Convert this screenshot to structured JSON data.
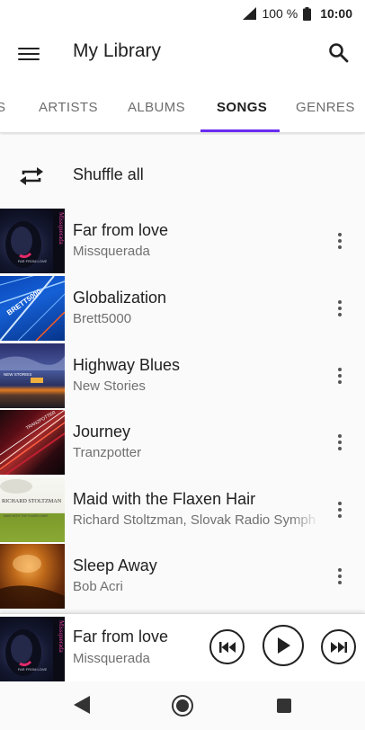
{
  "status": {
    "battery_percent": "100 %",
    "time": "10:00",
    "icons": [
      "signal-icon",
      "battery-icon"
    ]
  },
  "app": {
    "title": "My Library",
    "icons": [
      "menu-icon",
      "search-icon"
    ]
  },
  "tabs": [
    {
      "label": "S"
    },
    {
      "label": "ARTISTS"
    },
    {
      "label": "ALBUMS"
    },
    {
      "label": "SONGS",
      "active": true
    },
    {
      "label": "GENRES"
    }
  ],
  "accent_color": "#6a2bf2",
  "shuffle": {
    "label": "Shuffle all",
    "icon": "shuffle-icon"
  },
  "songs": [
    {
      "title": "Far from love",
      "artist": "Missquerada"
    },
    {
      "title": "Globalization",
      "artist": "Brett5000"
    },
    {
      "title": "Highway Blues",
      "artist": "New Stories"
    },
    {
      "title": "Journey",
      "artist": "Tranzpotter"
    },
    {
      "title": "Maid with the Flaxen Hair",
      "artist": "Richard Stoltzman, Slovak Radio Symph"
    },
    {
      "title": "Sleep Away",
      "artist": "Bob Acri"
    }
  ],
  "album_art_text": {
    "missquerada": "Missquerada",
    "missquerada_sub": "FAR FROM LOVE",
    "brett": "BRETT5000",
    "highway": "NEW STORIES",
    "journey": "TRANZPOTTER",
    "maid_top": "RICHARD STOLTZMAN",
    "maid_sub": "MAID WITH THE FLAXEN HAIR"
  },
  "now_playing": {
    "title": "Far from love",
    "artist": "Missquerada",
    "controls": [
      "previous-icon",
      "play-icon",
      "next-icon"
    ]
  },
  "nav": [
    "back-icon",
    "home-icon",
    "recents-icon"
  ]
}
